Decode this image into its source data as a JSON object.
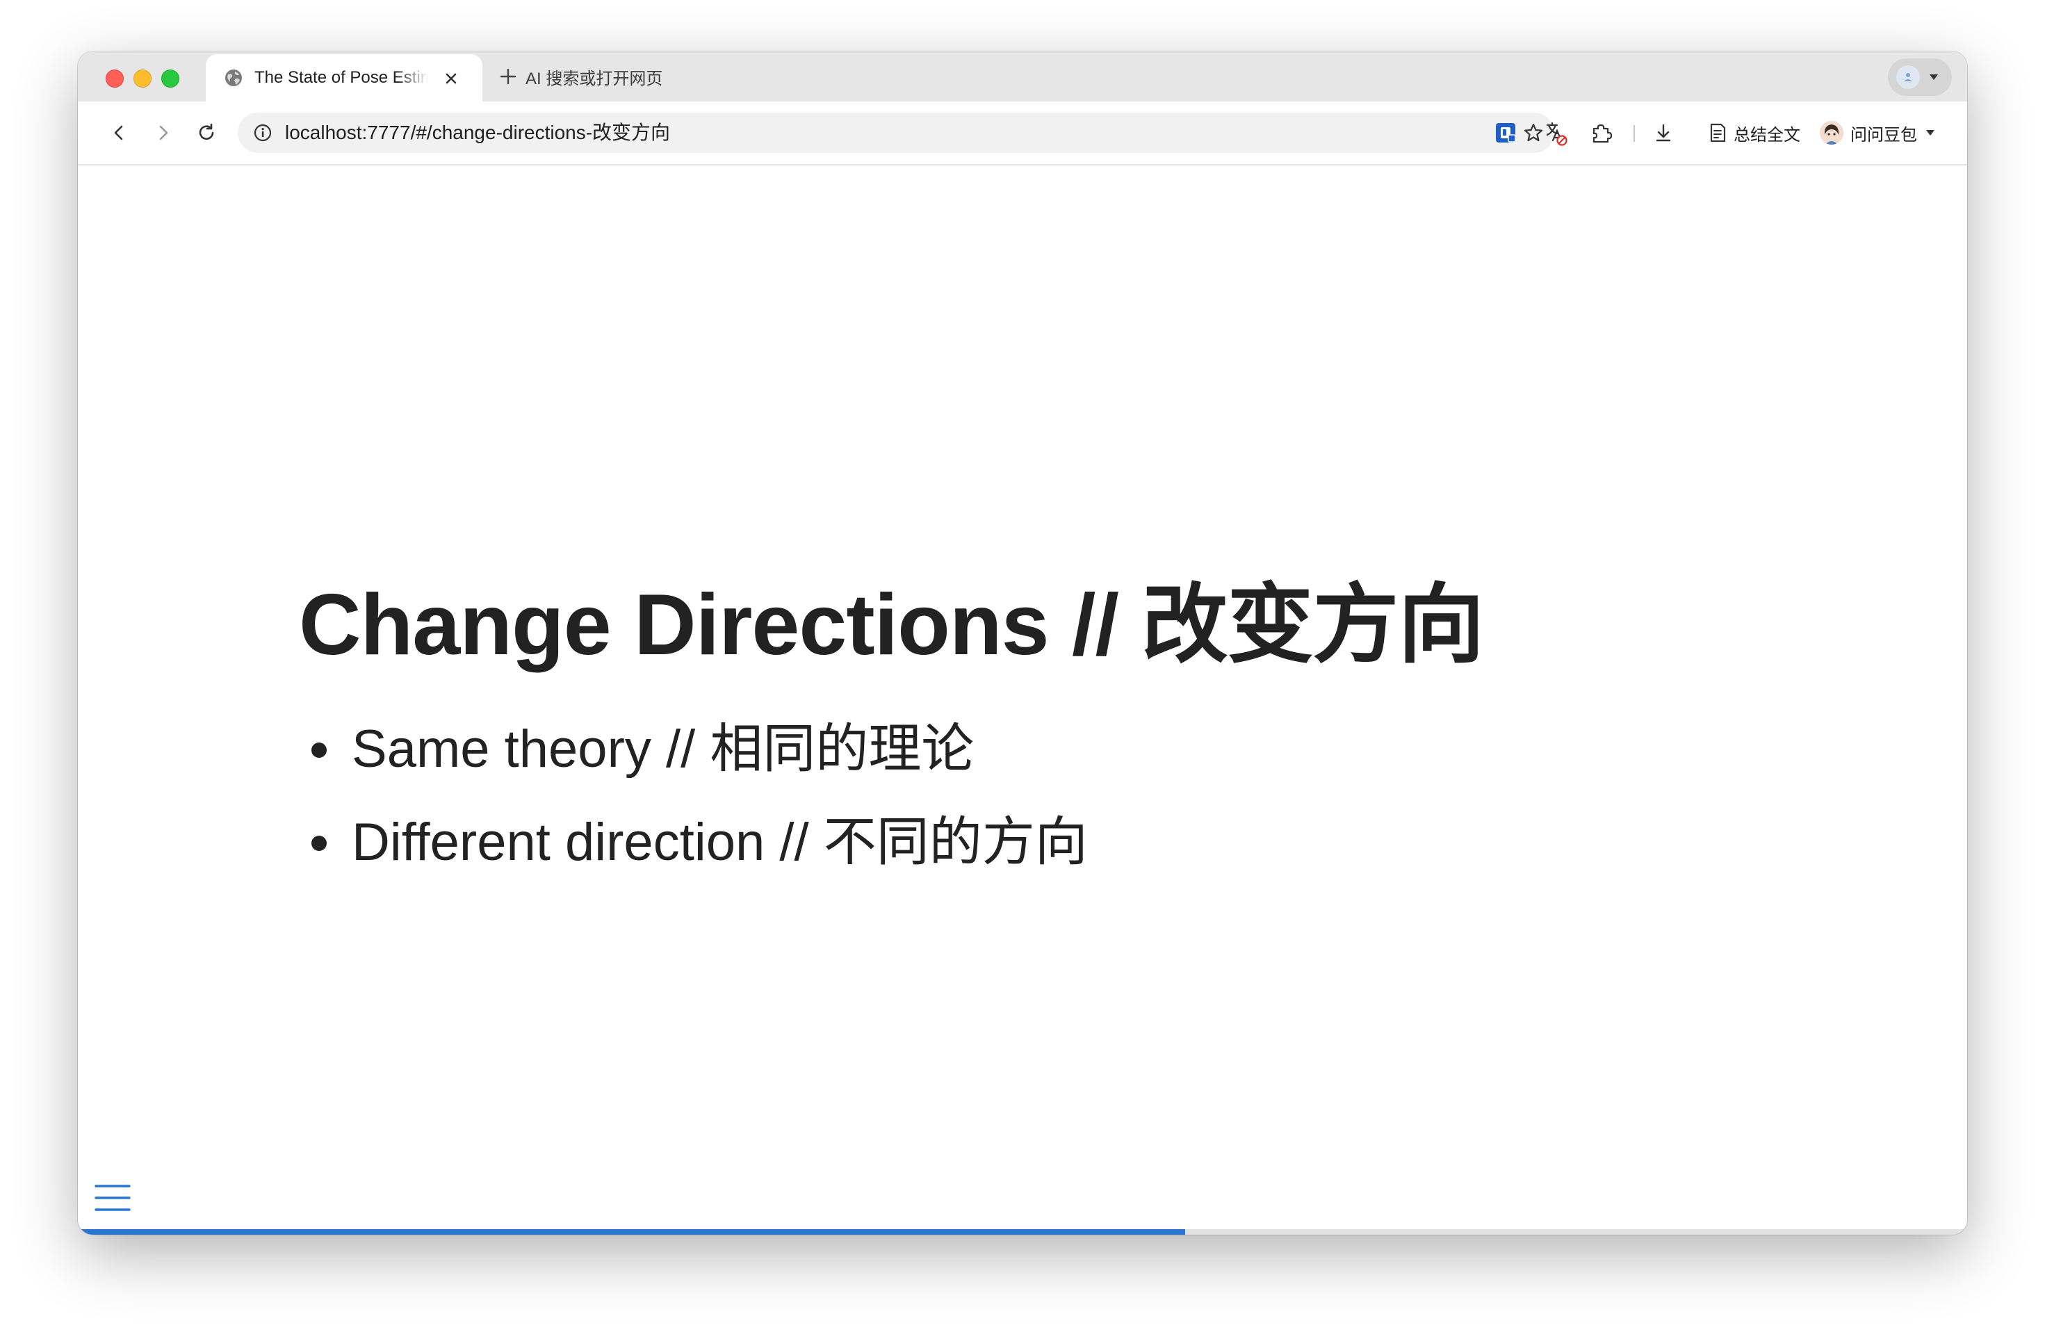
{
  "browser": {
    "tab": {
      "title": "The State of Pose Estimation",
      "favicon": "globe-icon",
      "close_icon": "close-icon"
    },
    "new_tab": {
      "label": "AI 搜索或打开网页",
      "icon": "plus-icon"
    },
    "address_bar": {
      "url": "localhost:7777/#/change-directions-改变方向",
      "leading_icon": "info-icon",
      "trailing_icon": "star-icon"
    },
    "toolbar": {
      "summary_label": "总结全文",
      "assistant_label": "问问豆包"
    }
  },
  "slide": {
    "title": "Change Directions // 改变方向",
    "bullets": [
      "Same theory // 相同的理论",
      "Different direction // 不同的方向"
    ],
    "progress": 0.586
  },
  "colors": {
    "accent": "#2a76d2",
    "text": "#222222",
    "tabbar": "#e6e6e6"
  }
}
